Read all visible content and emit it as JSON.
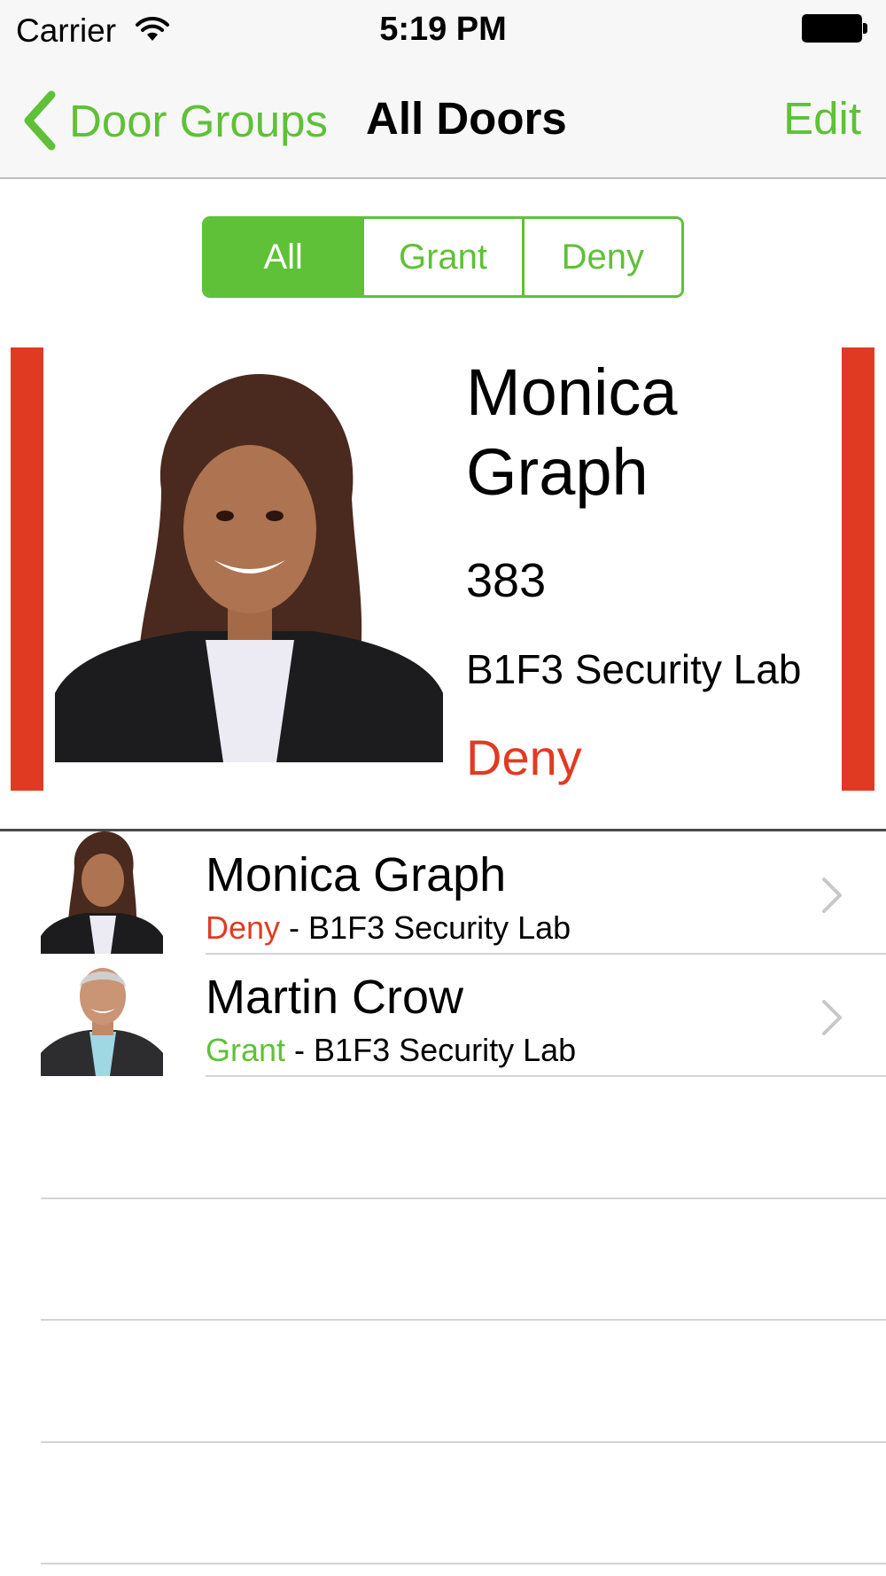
{
  "status_bar": {
    "carrier": "Carrier",
    "time": "5:19 PM",
    "icons": [
      "wifi-icon",
      "battery-icon"
    ]
  },
  "nav": {
    "back_label": "Door Groups",
    "title": "All Doors",
    "edit_label": "Edit"
  },
  "filter": {
    "segments": [
      "All",
      "Grant",
      "Deny"
    ],
    "selected": "All"
  },
  "featured": {
    "name": "Monica Graph",
    "room": "383",
    "door": "B1F3 Security Lab",
    "status": "Deny"
  },
  "list": {
    "rows": [
      {
        "name": "Monica Graph",
        "status": "Deny",
        "separator": " - ",
        "door": "B1F3 Security Lab"
      },
      {
        "name": "Martin Crow",
        "status": "Grant",
        "separator": " - ",
        "door": "B1F3 Security Lab"
      }
    ]
  },
  "colors": {
    "accent_green": "#5ec137",
    "deny_red": "#e03b22",
    "nav_background": "#f7f7f7"
  }
}
